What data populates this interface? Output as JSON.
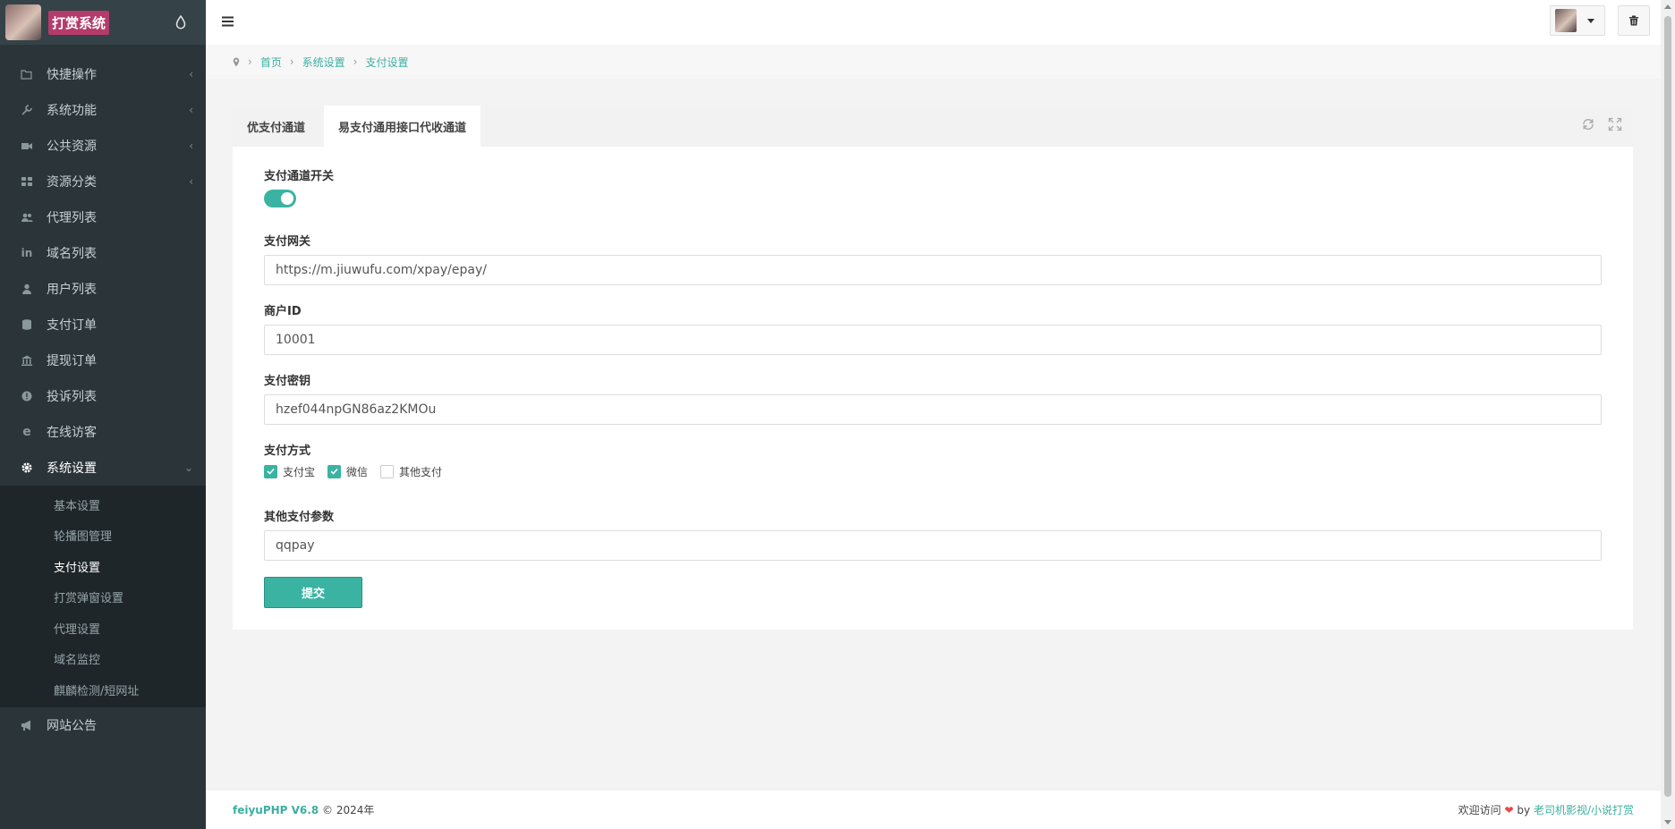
{
  "sidebar": {
    "brand": "打赏系统",
    "items": [
      {
        "label": "快捷操作",
        "icon": "folder-open-icon",
        "has_arrow": true
      },
      {
        "label": "系统功能",
        "icon": "wrench-icon",
        "has_arrow": true
      },
      {
        "label": "公共资源",
        "icon": "video-camera-icon",
        "has_arrow": true
      },
      {
        "label": "资源分类",
        "icon": "grid-icon",
        "has_arrow": true
      },
      {
        "label": "代理列表",
        "icon": "users-icon",
        "has_arrow": false
      },
      {
        "label": "域名列表",
        "icon": "linkedin-icon",
        "has_arrow": false
      },
      {
        "label": "用户列表",
        "icon": "user-icon",
        "has_arrow": false
      },
      {
        "label": "支付订单",
        "icon": "database-icon",
        "has_arrow": false
      },
      {
        "label": "提现订单",
        "icon": "bank-icon",
        "has_arrow": false
      },
      {
        "label": "投诉列表",
        "icon": "exclamation-circle-icon",
        "has_arrow": false
      },
      {
        "label": "在线访客",
        "icon": "ie-icon",
        "has_arrow": false
      },
      {
        "label": "系统设置",
        "icon": "gear-icon",
        "has_arrow": true
      }
    ],
    "subitems": [
      {
        "label": "基本设置"
      },
      {
        "label": "轮播图管理"
      },
      {
        "label": "支付设置"
      },
      {
        "label": "打赏弹窗设置"
      },
      {
        "label": "代理设置"
      },
      {
        "label": "域名监控"
      },
      {
        "label": "麒麟检测/短网址"
      }
    ],
    "last_item": {
      "label": "网站公告",
      "icon": "bullhorn-icon"
    }
  },
  "breadcrumb": {
    "home": "首页",
    "level1": "系统设置",
    "level2": "支付设置"
  },
  "tabs": [
    {
      "label": "优支付通道"
    },
    {
      "label": "易支付通用接口代收通道"
    }
  ],
  "form": {
    "switch_label": "支付通道开关",
    "switch_on": true,
    "gateway_label": "支付网关",
    "gateway_value": "https://m.jiuwufu.com/xpay/epay/",
    "merchant_label": "商户ID",
    "merchant_value": "10001",
    "key_label": "支付密钥",
    "key_value": "hzef044npGN86az2KMOu",
    "methods_label": "支付方式",
    "methods": [
      {
        "label": "支付宝",
        "checked": true
      },
      {
        "label": "微信",
        "checked": true
      },
      {
        "label": "其他支付",
        "checked": false
      }
    ],
    "other_label": "其他支付参数",
    "other_value": "qqpay",
    "submit_label": "提交"
  },
  "footer": {
    "brand": "feiyuPHP V6.8",
    "copyright": "© 2024年",
    "welcome": "欢迎访问",
    "by": "by",
    "link": "老司机影视/小说打赏"
  },
  "colors": {
    "accent": "#3bb3a2",
    "sidebar_bg": "#2b3539",
    "submenu_bg": "#1f2629"
  }
}
